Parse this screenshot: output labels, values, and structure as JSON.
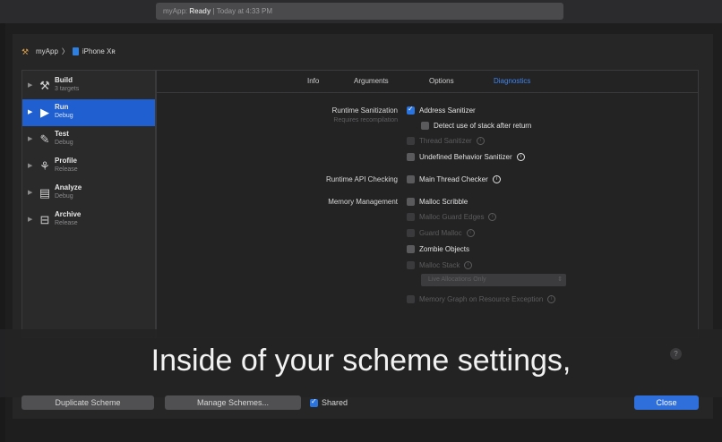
{
  "window": {
    "status_app": "myApp:",
    "status_state": "Ready",
    "status_time": "| Today at 4:33 PM"
  },
  "scheme": {
    "name": "myApp",
    "separator": "〉",
    "device": "iPhone Xʀ"
  },
  "actions": [
    {
      "name": "Build",
      "sub": "3 targets",
      "icon": "hammer-icon",
      "glyph": "⚒",
      "selected": false
    },
    {
      "name": "Run",
      "sub": "Debug",
      "icon": "play-icon",
      "glyph": "▶",
      "selected": true
    },
    {
      "name": "Test",
      "sub": "Debug",
      "icon": "wrench-icon",
      "glyph": "✎",
      "selected": false
    },
    {
      "name": "Profile",
      "sub": "Release",
      "icon": "instruments-icon",
      "glyph": "⚘",
      "selected": false
    },
    {
      "name": "Analyze",
      "sub": "Debug",
      "icon": "analyze-icon",
      "glyph": "▤",
      "selected": false
    },
    {
      "name": "Archive",
      "sub": "Release",
      "icon": "archive-icon",
      "glyph": "⊟",
      "selected": false
    }
  ],
  "tabs": [
    "Info",
    "Arguments",
    "Options",
    "Diagnostics"
  ],
  "active_tab": "Diagnostics",
  "sections": {
    "runtime_sanitization": {
      "label": "Runtime Sanitization",
      "sub": "Requires recompilation"
    },
    "runtime_api": {
      "label": "Runtime API Checking"
    },
    "memory": {
      "label": "Memory Management"
    }
  },
  "options": {
    "address_sanitizer": "Address Sanitizer",
    "detect_stack": "Detect use of stack after return",
    "thread_sanitizer": "Thread Sanitizer",
    "undefined_behavior": "Undefined Behavior Sanitizer",
    "main_thread_checker": "Main Thread Checker",
    "malloc_scribble": "Malloc Scribble",
    "malloc_guard_edges": "Malloc Guard Edges",
    "guard_malloc": "Guard Malloc",
    "zombie_objects": "Zombie Objects",
    "malloc_stack": "Malloc Stack",
    "live_allocations": "Live Allocations Only",
    "memory_graph": "Memory Graph on Resource Exception"
  },
  "caption": "Inside of your scheme settings,",
  "buttons": {
    "duplicate": "Duplicate Scheme",
    "manage": "Manage Schemes...",
    "shared": "Shared",
    "close": "Close"
  },
  "colors": {
    "accent": "#2f6fdc",
    "selection": "#1f5fcf",
    "tab_active": "#3d84f0"
  }
}
